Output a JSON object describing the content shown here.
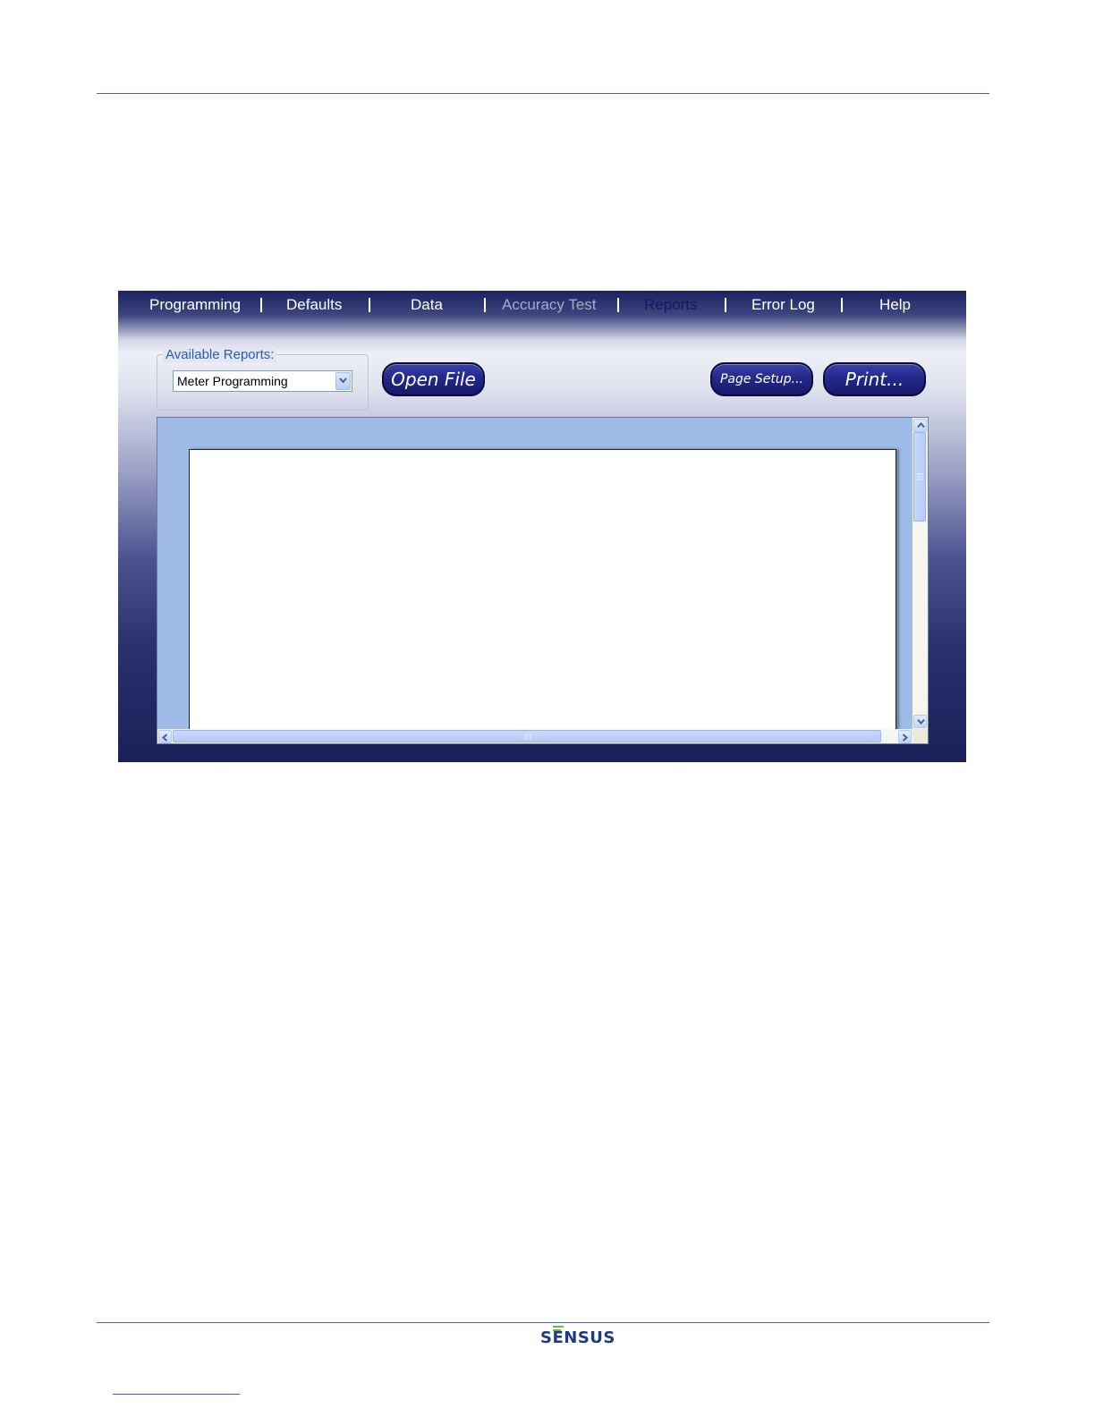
{
  "menu": {
    "items": [
      {
        "label": "Programming",
        "state": "normal"
      },
      {
        "label": "Defaults",
        "state": "normal"
      },
      {
        "label": "Data",
        "state": "normal"
      },
      {
        "label": "Accuracy Test",
        "state": "disabled"
      },
      {
        "label": "Reports",
        "state": "active"
      },
      {
        "label": "Error Log",
        "state": "normal"
      },
      {
        "label": "Help",
        "state": "normal"
      }
    ]
  },
  "reports": {
    "group_label": "Available Reports:",
    "selected_report": "Meter Programming"
  },
  "buttons": {
    "open_file": "Open File",
    "page_setup": "Page Setup...",
    "print": "Print..."
  },
  "footer": {
    "brand": "SENSUS"
  },
  "colors": {
    "menu_active": "#15186a",
    "menu_disabled": "#a7abc6",
    "button_fill": "#24288a",
    "viewer_background": "#9fbbe7",
    "brand_blue": "#1f3a84",
    "brand_green": "#6db33f"
  },
  "icons": {
    "dropdown": "chevron-down-icon",
    "scroll_up": "arrow-up-icon",
    "scroll_down": "arrow-down-icon",
    "scroll_left": "arrow-left-icon",
    "scroll_right": "arrow-right-icon"
  }
}
